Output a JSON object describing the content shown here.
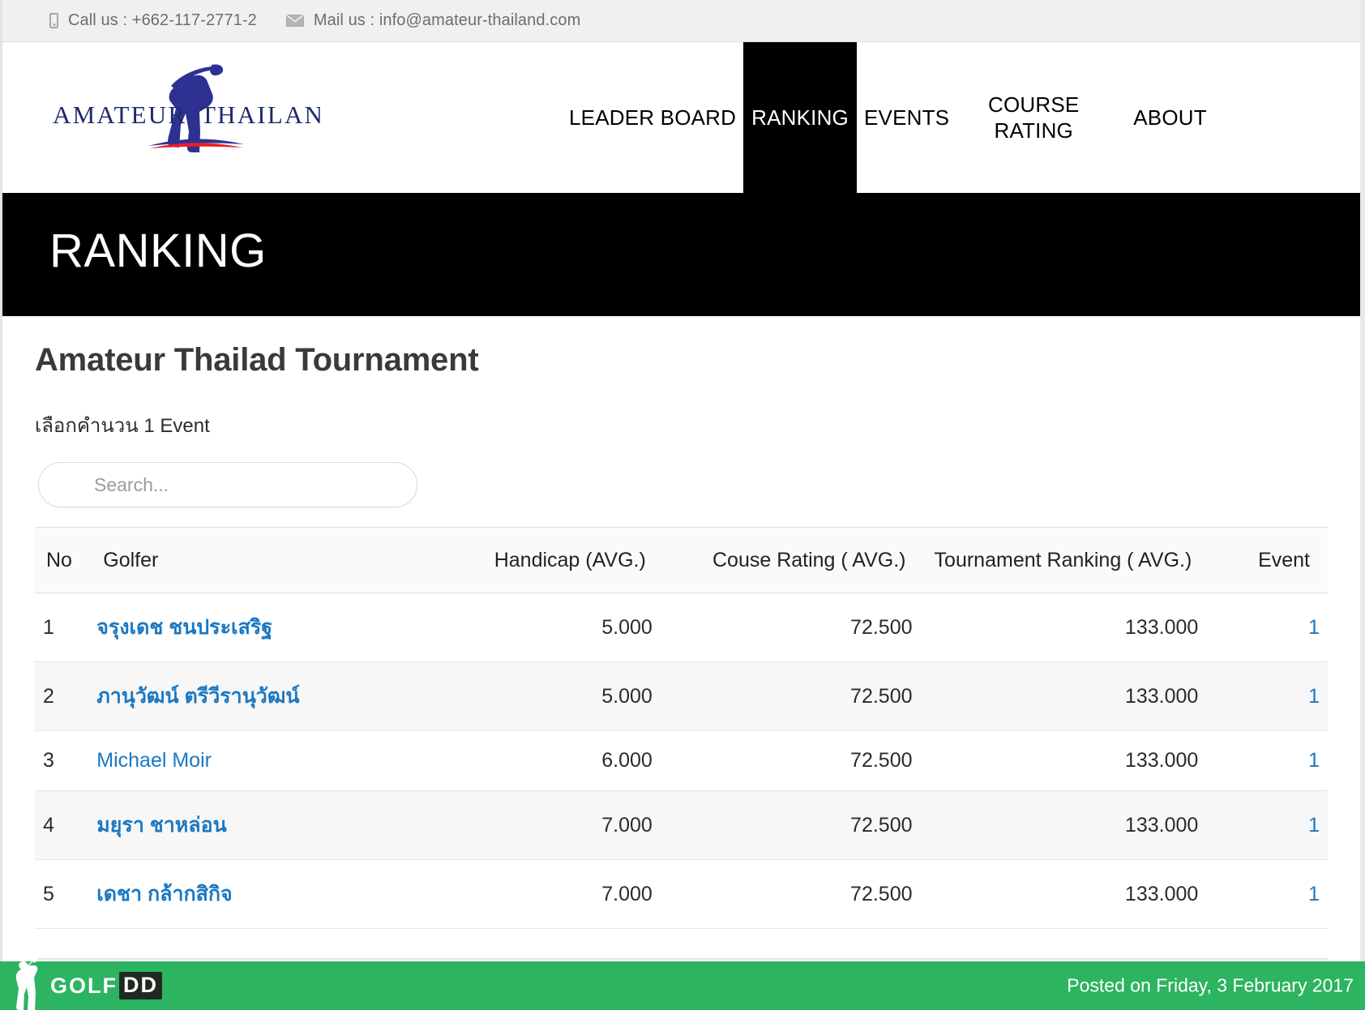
{
  "topbar": {
    "phone_icon": "phone-icon",
    "phone_text": "Call us : +662-117-2771-2",
    "mail_icon": "mail-icon",
    "mail_text": "Mail us : info@amateur-thailand.com"
  },
  "brand": {
    "logo_text_left": "AMATEUR",
    "logo_text_right": "THAILAND",
    "logo_navy": "#2e3192",
    "logo_red": "#ed1c24"
  },
  "nav": {
    "items": [
      {
        "label": "LEADER BOARD",
        "active": false
      },
      {
        "label": "RANKING",
        "active": true
      },
      {
        "label": "EVENTS",
        "active": false
      },
      {
        "label": "COURSE RATING",
        "active": false
      },
      {
        "label": "ABOUT",
        "active": false
      }
    ]
  },
  "banner": {
    "title": "RANKING"
  },
  "main": {
    "heading": "Amateur Thailad Tournament",
    "subnote": "เลือกคำนวน 1 Event",
    "search": {
      "placeholder": "Search...",
      "value": ""
    }
  },
  "table": {
    "headers": {
      "no": "No",
      "golfer": "Golfer",
      "handicap": "Handicap (AVG.)",
      "course_rating": "Couse Rating ( AVG.)",
      "tournament_ranking": "Tournament Ranking ( AVG.)",
      "event": "Event"
    },
    "rows": [
      {
        "no": "1",
        "golfer": "จรุงเดช ชนประเสริฐ",
        "latin": false,
        "handicap": "5.000",
        "course_rating": "72.500",
        "tournament_ranking": "133.000",
        "event": "1"
      },
      {
        "no": "2",
        "golfer": "ภานุวัฒน์ ตรีวีรานุวัฒน์",
        "latin": false,
        "handicap": "5.000",
        "course_rating": "72.500",
        "tournament_ranking": "133.000",
        "event": "1"
      },
      {
        "no": "3",
        "golfer": "Michael Moir",
        "latin": true,
        "handicap": "6.000",
        "course_rating": "72.500",
        "tournament_ranking": "133.000",
        "event": "1"
      },
      {
        "no": "4",
        "golfer": "มยุรา ชาหล่อน",
        "latin": false,
        "handicap": "7.000",
        "course_rating": "72.500",
        "tournament_ranking": "133.000",
        "event": "1"
      },
      {
        "no": "5",
        "golfer": "เดชา กล้ากสิกิจ",
        "latin": false,
        "handicap": "7.000",
        "course_rating": "72.500",
        "tournament_ranking": "133.000",
        "event": "1"
      }
    ]
  },
  "footer": {
    "golfer_icon": "golfer-swing-icon",
    "logo_golf": "GOLF",
    "logo_dd": "DD",
    "posted": "Posted on Friday, 3 February 2017",
    "bg_color": "#2cb461"
  },
  "colors": {
    "link_blue": "#1b78c2",
    "banner_black": "#000000",
    "footer_green": "#2cb461"
  }
}
